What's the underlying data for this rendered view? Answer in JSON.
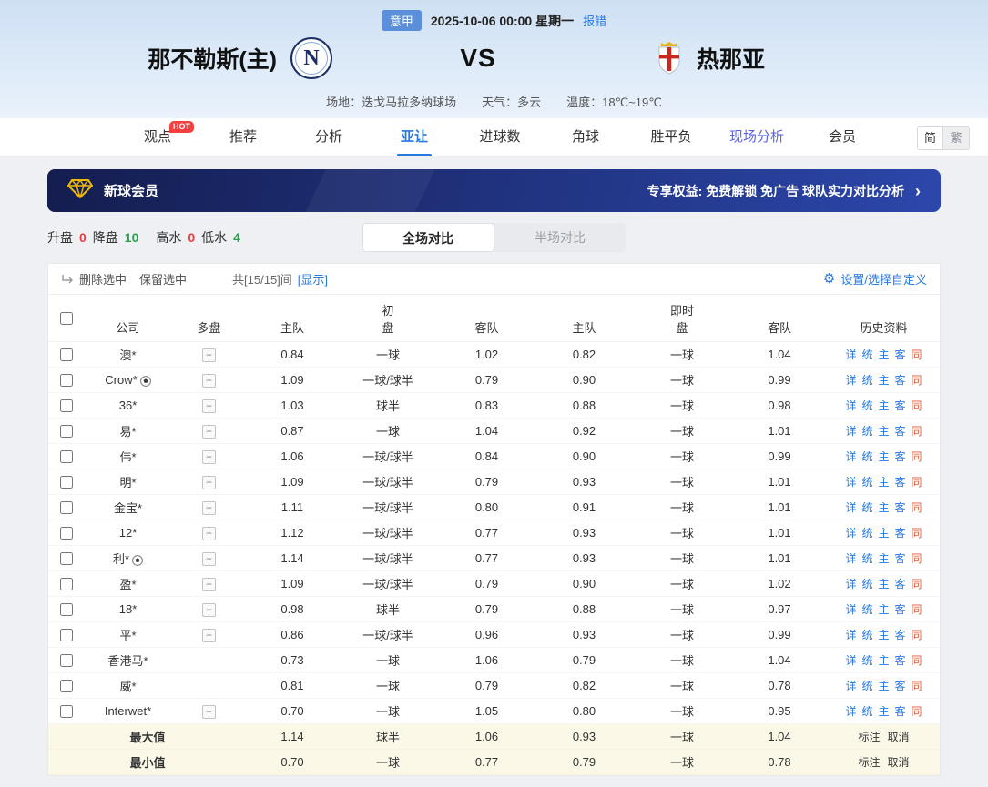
{
  "match": {
    "league": "意甲",
    "datetime": "2025-10-06 00:00 星期一",
    "report_error": "报错",
    "home_name": "那不勒斯(主)",
    "home_logo_letter": "N",
    "vs": "VS",
    "away_name": "热那亚",
    "venue": "场地：迭戈马拉多纳球场",
    "weather": "天气：多云",
    "temperature": "温度：18℃~19℃"
  },
  "nav": {
    "items": [
      "观点",
      "推荐",
      "分析",
      "亚让",
      "进球数",
      "角球",
      "胜平负",
      "现场分析",
      "会员"
    ],
    "hot_badge": "HOT",
    "lang_simplified": "简",
    "lang_traditional": "繁"
  },
  "promo": {
    "title": "新球会员",
    "benefits": "专享权益: 免费解锁 免广告 球队实力对比分析",
    "arrow": "›"
  },
  "filters": {
    "stats": [
      {
        "label": "升盘",
        "value": "0"
      },
      {
        "label": "降盘",
        "value": "10"
      },
      {
        "label": "高水",
        "value": "0"
      },
      {
        "label": "低水",
        "value": "4"
      }
    ],
    "tab_full": "全场对比",
    "tab_half": "半场对比"
  },
  "toolbar": {
    "delete_selected": "删除选中",
    "keep_selected": "保留选中",
    "count_text": "共[15/15]间",
    "show_link": "[显示]",
    "settings": "设置/选择自定义"
  },
  "table": {
    "header": {
      "company": "公司",
      "multi": "多盘",
      "initial": "初",
      "live": "即时",
      "home": "主队",
      "handicap": "盘",
      "away": "客队",
      "history": "历史资料"
    },
    "multi_expand_label": "+",
    "history_links": [
      "详",
      "统",
      "主",
      "客",
      "同"
    ],
    "rows": [
      {
        "company": "澳*",
        "badge": false,
        "multi": true,
        "init": [
          "0.84",
          "一球",
          "1.02"
        ],
        "live": [
          "0.82",
          "一球",
          "1.04"
        ]
      },
      {
        "company": "Crow*",
        "badge": true,
        "multi": true,
        "init": [
          "1.09",
          "一球/球半",
          "0.79"
        ],
        "live": [
          "0.90",
          "一球",
          "0.99"
        ]
      },
      {
        "company": "36*",
        "badge": false,
        "multi": true,
        "init": [
          "1.03",
          "球半",
          "0.83"
        ],
        "live": [
          "0.88",
          "一球",
          "0.98"
        ]
      },
      {
        "company": "易*",
        "badge": false,
        "multi": true,
        "init": [
          "0.87",
          "一球",
          "1.04"
        ],
        "live": [
          "0.92",
          "一球",
          "1.01"
        ]
      },
      {
        "company": "伟*",
        "badge": false,
        "multi": true,
        "init": [
          "1.06",
          "一球/球半",
          "0.84"
        ],
        "live": [
          "0.90",
          "一球",
          "0.99"
        ]
      },
      {
        "company": "明*",
        "badge": false,
        "multi": true,
        "init": [
          "1.09",
          "一球/球半",
          "0.79"
        ],
        "live": [
          "0.93",
          "一球",
          "1.01"
        ]
      },
      {
        "company": "金宝*",
        "badge": false,
        "multi": true,
        "init": [
          "1.11",
          "一球/球半",
          "0.80"
        ],
        "live": [
          "0.91",
          "一球",
          "1.01"
        ]
      },
      {
        "company": "12*",
        "badge": false,
        "multi": true,
        "init": [
          "1.12",
          "一球/球半",
          "0.77"
        ],
        "live": [
          "0.93",
          "一球",
          "1.01"
        ]
      },
      {
        "company": "利*",
        "badge": true,
        "multi": true,
        "init": [
          "1.14",
          "一球/球半",
          "0.77"
        ],
        "live": [
          "0.93",
          "一球",
          "1.01"
        ]
      },
      {
        "company": "盈*",
        "badge": false,
        "multi": true,
        "init": [
          "1.09",
          "一球/球半",
          "0.79"
        ],
        "live": [
          "0.90",
          "一球",
          "1.02"
        ]
      },
      {
        "company": "18*",
        "badge": false,
        "multi": true,
        "init": [
          "0.98",
          "球半",
          "0.79"
        ],
        "live": [
          "0.88",
          "一球",
          "0.97"
        ]
      },
      {
        "company": "平*",
        "badge": false,
        "multi": true,
        "init": [
          "0.86",
          "一球/球半",
          "0.96"
        ],
        "live": [
          "0.93",
          "一球",
          "0.99"
        ]
      },
      {
        "company": "香港马*",
        "badge": false,
        "multi": false,
        "init": [
          "0.73",
          "一球",
          "1.06"
        ],
        "live": [
          "0.79",
          "一球",
          "1.04"
        ]
      },
      {
        "company": "威*",
        "badge": false,
        "multi": false,
        "init": [
          "0.81",
          "一球",
          "0.79"
        ],
        "live": [
          "0.82",
          "一球",
          "0.78"
        ]
      },
      {
        "company": "Interwet*",
        "badge": false,
        "multi": true,
        "init": [
          "0.70",
          "一球",
          "1.05"
        ],
        "live": [
          "0.80",
          "一球",
          "0.95"
        ]
      }
    ],
    "footer": [
      {
        "label": "最大值",
        "init": [
          "1.14",
          "球半",
          "1.06"
        ],
        "live": [
          "0.93",
          "一球",
          "1.04"
        ],
        "actions": [
          "标注",
          "取消"
        ]
      },
      {
        "label": "最小值",
        "init": [
          "0.70",
          "一球",
          "0.77"
        ],
        "live": [
          "0.79",
          "一球",
          "0.78"
        ],
        "actions": [
          "标注",
          "取消"
        ]
      }
    ]
  },
  "colors": {
    "accent_blue": "#2779e0",
    "up_red": "#e34040",
    "down_green": "#2ca24c",
    "history_same_red": "#e05b3c"
  }
}
